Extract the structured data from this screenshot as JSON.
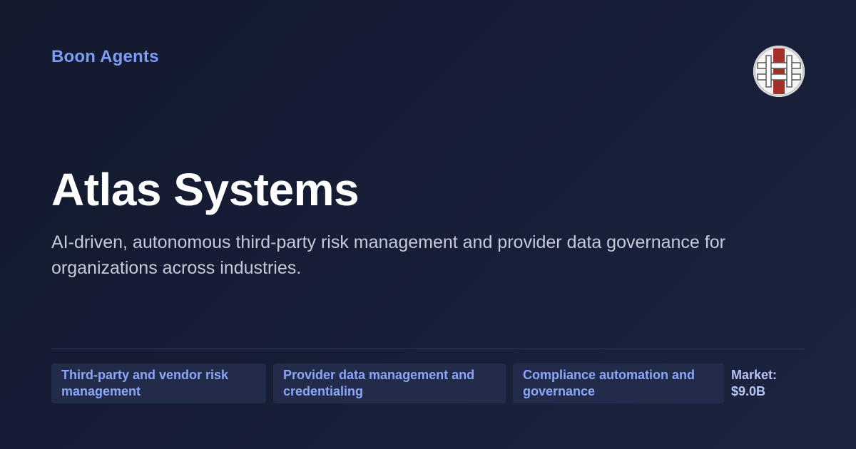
{
  "brand": {
    "name": "Boon Agents"
  },
  "company": {
    "name": "Atlas Systems",
    "description": "AI-driven, autonomous third-party risk management and provider data governance for organizations across industries."
  },
  "tags": [
    {
      "label": "Third-party and vendor risk management"
    },
    {
      "label": "Provider data management and credentialing"
    },
    {
      "label": "Compliance automation and governance"
    }
  ],
  "market": {
    "label": "Market:",
    "value": "$9.0B"
  },
  "logo": {
    "icon": "company-logo-icon",
    "colors": {
      "background": "#f4f4f4",
      "accent": "#a3312a",
      "outline": "#5a5a5a"
    }
  },
  "colors": {
    "background": "#151c32",
    "brand": "#7f9cf5",
    "title": "#ffffff",
    "description": "#c4cad9",
    "tag_background": "#222c4a",
    "tag_text": "#8ba6f7"
  }
}
